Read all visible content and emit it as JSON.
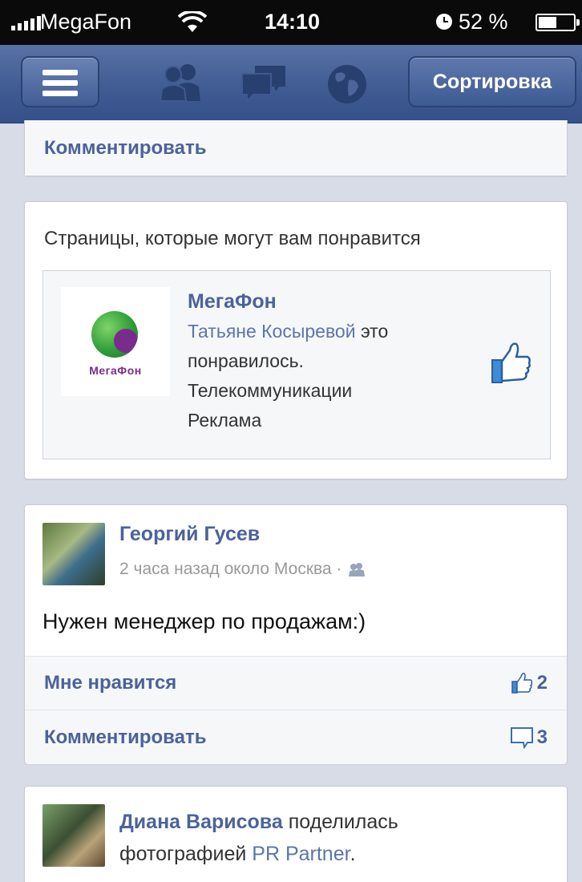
{
  "status_bar": {
    "carrier": "MegaFon",
    "time": "14:10",
    "battery_percent": "52 %",
    "battery_level": 0.52
  },
  "navbar": {
    "sort_label": "Сортировка",
    "icons": [
      "menu-icon",
      "friends-icon",
      "messages-icon",
      "globe-icon"
    ]
  },
  "top_card": {
    "comment_label": "Комментировать"
  },
  "suggestions": {
    "title": "Страницы, которые могут вам понравится",
    "page": {
      "logo_text": "МегаФон",
      "name": "МегаФон",
      "friend": "Татьяне Косыревой",
      "liked_prefix": "это",
      "liked_suffix": "понравилось.",
      "category": "Телекоммуникации",
      "sponsored": "Реклама"
    }
  },
  "post": {
    "author": "Георгий Гусев",
    "meta": "2 часа назад около Москва ·",
    "text": "Нужен менеджер по продажам:)",
    "like_label": "Мне нравится",
    "like_count": "2",
    "comment_label": "Комментировать",
    "comment_count": "3"
  },
  "shared_post": {
    "author": "Диана Варисова",
    "action": "поделилась",
    "action2": "фотографией",
    "page": "PR Partner",
    "end": "."
  },
  "colors": {
    "navbar": "#3f5a91",
    "link": "#4b639a",
    "background": "#d8dce6"
  }
}
